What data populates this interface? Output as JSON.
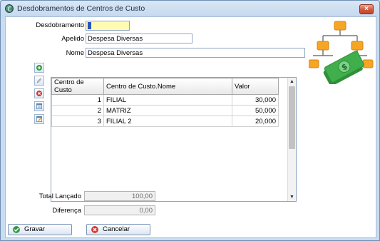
{
  "window": {
    "title": "Desdobramentos de Centros de Custo",
    "close_label": "×"
  },
  "form": {
    "desdobramento_label": "Desdobramento",
    "desdobramento_value": "1",
    "apelido_label": "Apelido",
    "apelido_value": "Despesa Diversas",
    "nome_label": "Nome",
    "nome_value": "Despesa Diversas"
  },
  "grid": {
    "columns": [
      "Centro de Custo",
      "Centro de Custo.Nome",
      "Valor"
    ],
    "rows": [
      {
        "centro": "1",
        "nome": "FILIAL",
        "valor": "30,000"
      },
      {
        "centro": "2",
        "nome": "MATRIZ",
        "valor": "50,000"
      },
      {
        "centro": "3",
        "nome": "FILIAL 2",
        "valor": "20,000"
      }
    ],
    "scroll_up": "▲",
    "scroll_down": "▼"
  },
  "totals": {
    "total_label": "Total Lançado",
    "total_value": "100,00",
    "diferenca_label": "Diferença",
    "diferenca_value": "0,00"
  },
  "buttons": {
    "gravar": "Gravar",
    "cancelar": "Cancelar"
  },
  "toolbar_icons": [
    "add-icon",
    "edit-icon",
    "delete-icon",
    "list-icon",
    "list-edit-icon"
  ],
  "colors": {
    "add": "#2e9a3a",
    "delete": "#d8342a",
    "accent": "#f5a623",
    "money": "#3fae4b"
  }
}
